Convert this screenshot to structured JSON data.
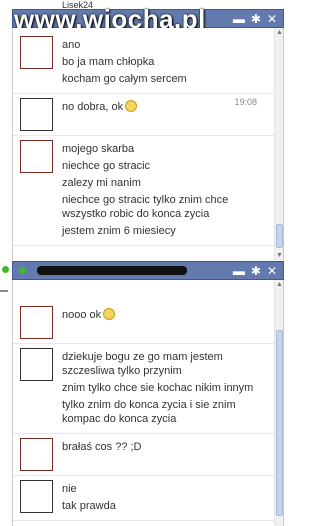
{
  "watermark": "www.wiocha.pl",
  "top_partial_name": "Lisek24",
  "chat1": {
    "groups": [
      {
        "lines": [
          "ano",
          "bo ja mam chłopka",
          "kocham go całym sercem"
        ]
      },
      {
        "time": "19:08",
        "lines": [
          "no dobra, ok"
        ],
        "emoji_after": [
          0
        ]
      },
      {
        "lines": [
          "mojego skarba",
          "niechce go stracic",
          "zalezy mi nanim",
          "niechce go stracic tylko znim chce wszystko robic do konca zycia",
          "jestem znim 6 miesiecy"
        ]
      }
    ]
  },
  "chat2": {
    "groups": [
      {
        "lines": [
          "nooo ok"
        ],
        "emoji_after": [
          0
        ]
      },
      {
        "lines": [
          "dziekuje bogu ze go mam jestem szczesliwa tylko przynim",
          "znim tylko chce sie kochac nikim innym",
          "tylko znim do konca zycia i sie znim kompac do konca zycia"
        ]
      },
      {
        "lines": [
          "brałaś cos ?? ;D"
        ]
      },
      {
        "lines": [
          "nie",
          "tak prawda"
        ]
      }
    ]
  },
  "icons": {
    "video": "video-camera-icon",
    "settings": "gear-icon",
    "close": "close-icon",
    "video_glyph": "▬",
    "settings_glyph": "✱",
    "close_glyph": "✕"
  },
  "colors": {
    "header_bg": "#627aad",
    "header_border": "#3b5998",
    "online": "#42b72a"
  }
}
